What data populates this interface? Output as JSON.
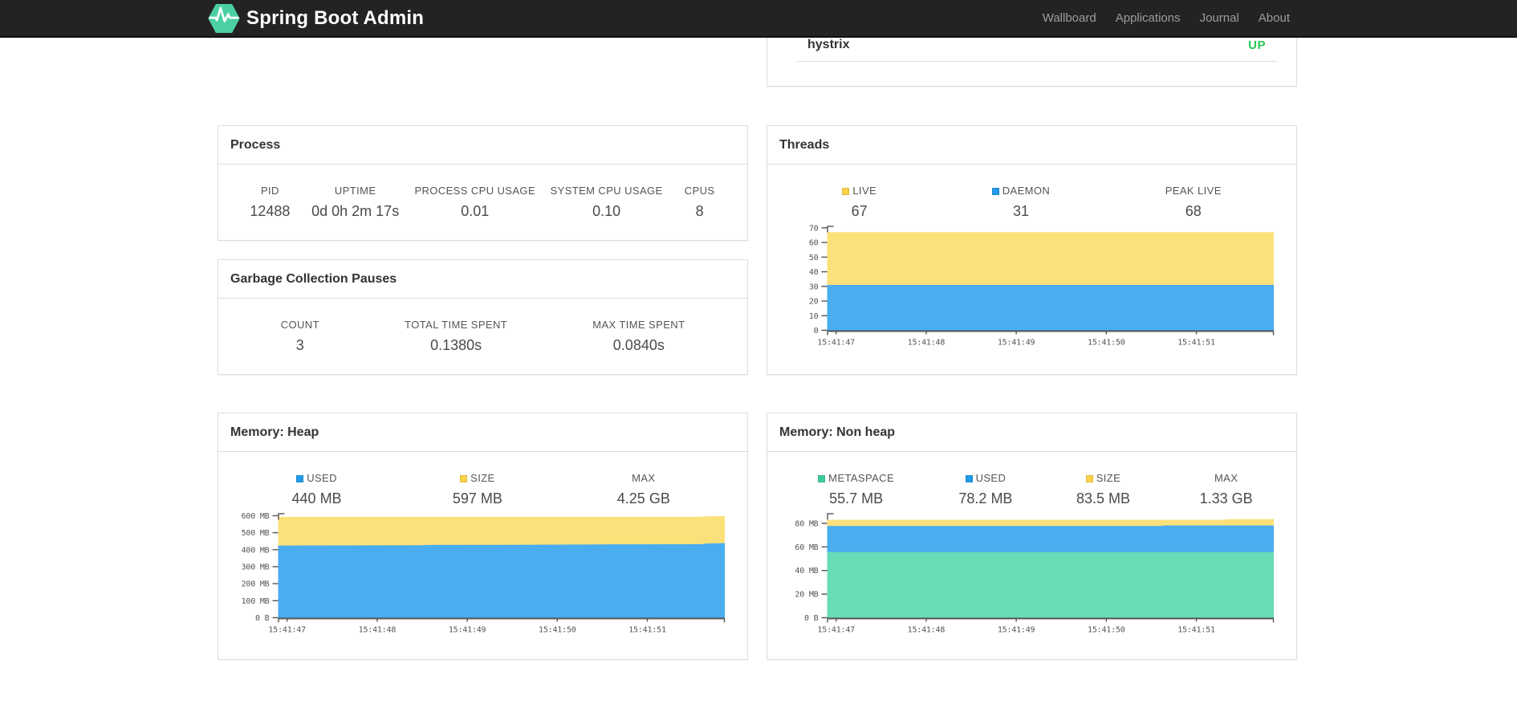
{
  "navbar": {
    "brand": "Spring Boot Admin",
    "links": [
      {
        "label": "Wallboard"
      },
      {
        "label": "Applications"
      },
      {
        "label": "Journal"
      },
      {
        "label": "About"
      }
    ]
  },
  "colors": {
    "brand_green": "#4bcfa3",
    "status_up": "#22c955",
    "series_yellow": "#fcd348",
    "series_blue": "#209bea",
    "series_green": "#3dcd9c",
    "fill_yellow": "#fce07a",
    "fill_blue": "#49adf0",
    "fill_green": "#68dbb7",
    "axis": "#545454"
  },
  "health_panel": {
    "item": "hystrix",
    "status": "UP"
  },
  "panels": {
    "process": {
      "title": "Process",
      "metrics": [
        {
          "label": "PID",
          "value": "12488"
        },
        {
          "label": "UPTIME",
          "value": "0d 0h 2m 17s"
        },
        {
          "label": "PROCESS CPU USAGE",
          "value": "0.01"
        },
        {
          "label": "SYSTEM CPU USAGE",
          "value": "0.10"
        },
        {
          "label": "CPUS",
          "value": "8"
        }
      ]
    },
    "gc": {
      "title": "Garbage Collection Pauses",
      "metrics": [
        {
          "label": "COUNT",
          "value": "3"
        },
        {
          "label": "TOTAL TIME SPENT",
          "value": "0.1380s"
        },
        {
          "label": "MAX TIME SPENT",
          "value": "0.0840s"
        }
      ]
    },
    "threads": {
      "title": "Threads",
      "legend": [
        {
          "label": "LIVE",
          "value": "67",
          "color": "#fcd348"
        },
        {
          "label": "DAEMON",
          "value": "31",
          "color": "#209bea"
        },
        {
          "label": "PEAK LIVE",
          "value": "68",
          "color": null
        }
      ]
    },
    "heap": {
      "title": "Memory: Heap",
      "legend": [
        {
          "label": "USED",
          "value": "440 MB",
          "color": "#209bea"
        },
        {
          "label": "SIZE",
          "value": "597 MB",
          "color": "#fcd348"
        },
        {
          "label": "MAX",
          "value": "4.25 GB",
          "color": null
        }
      ]
    },
    "nonheap": {
      "title": "Memory: Non heap",
      "legend": [
        {
          "label": "METASPACE",
          "value": "55.7 MB",
          "color": "#3dcd9c"
        },
        {
          "label": "USED",
          "value": "78.2 MB",
          "color": "#209bea"
        },
        {
          "label": "SIZE",
          "value": "83.5 MB",
          "color": "#fcd348"
        },
        {
          "label": "MAX",
          "value": "1.33 GB",
          "color": null
        }
      ]
    }
  },
  "chart_data": [
    {
      "id": "threads",
      "type": "area",
      "title": "Threads",
      "xlabel": "",
      "ylabel": "",
      "legend_position": "top",
      "grid": false,
      "xlim": [
        46.9,
        51.86
      ],
      "ylim": [
        0,
        71.3
      ],
      "xticks": [
        {
          "t": 47,
          "label": "15:41:47"
        },
        {
          "t": 48,
          "label": "15:41:48"
        },
        {
          "t": 49,
          "label": "15:41:49"
        },
        {
          "t": 50,
          "label": "15:41:50"
        },
        {
          "t": 51,
          "label": "15:41:51"
        }
      ],
      "yticks": [
        {
          "v": 0,
          "label": "0"
        },
        {
          "v": 10,
          "label": "10"
        },
        {
          "v": 20,
          "label": "20"
        },
        {
          "v": 30,
          "label": "30"
        },
        {
          "v": 40,
          "label": "40"
        },
        {
          "v": 50,
          "label": "50"
        },
        {
          "v": 60,
          "label": "60"
        },
        {
          "v": 70,
          "label": "70"
        }
      ],
      "series": [
        {
          "name": "LIVE",
          "color": "#fcd348",
          "fill": "#fce07a",
          "x": [
            46.9,
            51.86
          ],
          "values": [
            67,
            67
          ]
        },
        {
          "name": "DAEMON",
          "color": "#209bea",
          "fill": "#49adf0",
          "x": [
            46.9,
            51.86
          ],
          "values": [
            31,
            31
          ]
        }
      ]
    },
    {
      "id": "heap",
      "type": "area",
      "title": "Memory: Heap",
      "xlabel": "",
      "ylabel": "",
      "legend_position": "top",
      "grid": false,
      "xlim": [
        46.9,
        51.86
      ],
      "ylim": [
        0,
        614
      ],
      "xticks": [
        {
          "t": 47,
          "label": "15:41:47"
        },
        {
          "t": 48,
          "label": "15:41:48"
        },
        {
          "t": 49,
          "label": "15:41:49"
        },
        {
          "t": 50,
          "label": "15:41:50"
        },
        {
          "t": 51,
          "label": "15:41:51"
        }
      ],
      "yticks": [
        {
          "v": 0,
          "label": "0 B"
        },
        {
          "v": 100,
          "label": "100 MB"
        },
        {
          "v": 200,
          "label": "200 MB"
        },
        {
          "v": 300,
          "label": "300 MB"
        },
        {
          "v": 400,
          "label": "400 MB"
        },
        {
          "v": 500,
          "label": "500 MB"
        },
        {
          "v": 600,
          "label": "600 MB"
        }
      ],
      "series": [
        {
          "name": "USED",
          "color": "#209bea",
          "fill": "#49adf0",
          "x": [
            46.9,
            47.3,
            48.5,
            48.55,
            49.5,
            50.5,
            51.6,
            51.65,
            51.86
          ],
          "values": [
            424,
            425,
            426,
            428,
            429,
            431,
            432,
            436,
            439
          ]
        },
        {
          "name": "SIZE",
          "color": "#fcd348",
          "fill": "#fce07a",
          "x": [
            46.9,
            51.6,
            51.65,
            51.86
          ],
          "values": [
            593,
            593,
            597,
            597
          ]
        }
      ]
    },
    {
      "id": "nonheap",
      "type": "area",
      "title": "Memory: Non heap",
      "xlabel": "",
      "ylabel": "",
      "legend_position": "top",
      "grid": false,
      "xlim": [
        46.9,
        51.86
      ],
      "ylim": [
        0,
        88.5
      ],
      "xticks": [
        {
          "t": 47,
          "label": "15:41:47"
        },
        {
          "t": 48,
          "label": "15:41:48"
        },
        {
          "t": 49,
          "label": "15:41:49"
        },
        {
          "t": 50,
          "label": "15:41:50"
        },
        {
          "t": 51,
          "label": "15:41:51"
        }
      ],
      "yticks": [
        {
          "v": 0,
          "label": "0 B"
        },
        {
          "v": 20,
          "label": "20 MB"
        },
        {
          "v": 40,
          "label": "40 MB"
        },
        {
          "v": 60,
          "label": "60 MB"
        },
        {
          "v": 80,
          "label": "80 MB"
        }
      ],
      "series": [
        {
          "name": "METASPACE",
          "color": "#3dcd9c",
          "fill": "#68dbb7",
          "x": [
            46.9,
            51.86
          ],
          "values": [
            55.7,
            55.7
          ]
        },
        {
          "name": "USED",
          "color": "#209bea",
          "fill": "#49adf0",
          "x": [
            46.9,
            50.6,
            50.65,
            51.86
          ],
          "values": [
            77.8,
            77.8,
            78.2,
            78.2
          ]
        },
        {
          "name": "SIZE",
          "color": "#fcd348",
          "fill": "#fce07a",
          "x": [
            46.9,
            51.3,
            51.35,
            51.86
          ],
          "values": [
            83.0,
            83.0,
            83.5,
            83.5
          ]
        }
      ]
    }
  ]
}
